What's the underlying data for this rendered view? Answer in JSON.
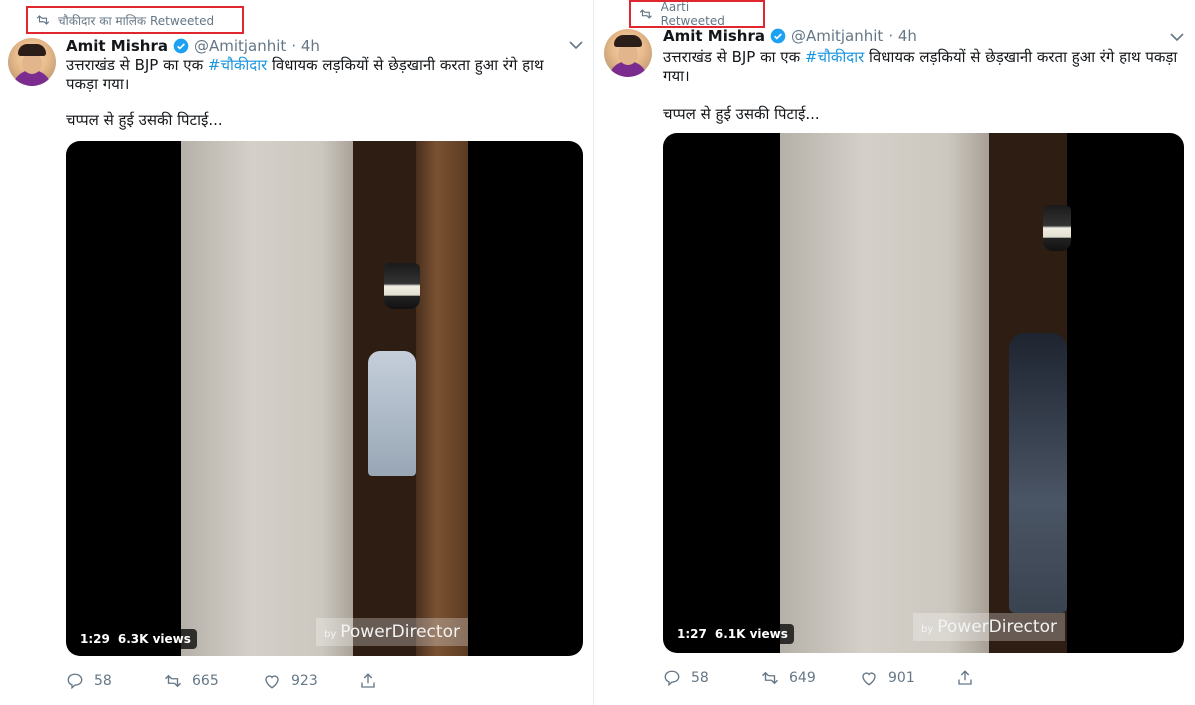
{
  "left": {
    "retweeted_by": "चौकीदार का मालिक",
    "retweeted_suffix": "Retweeted",
    "author_name": "Amit Mishra",
    "handle": "@Amitjanhit",
    "time": "· 4h",
    "text_before_hashtag": "उत्तराखंड से BJP का एक ",
    "hashtag": "#चौकीदार",
    "text_after_hashtag": " विधायक लड़कियों से छेड़खानी करता हुआ रंगे हाथ पकड़ा गया।",
    "text_line2": "चप्पल से हुई उसकी पिटाई...",
    "video_duration": "1:29",
    "video_views": "6.3K views",
    "watermark_small": "by",
    "watermark": "PowerDirector",
    "replies": "58",
    "retweets": "665",
    "likes": "923"
  },
  "right": {
    "retweeted_by": "Aarti",
    "retweeted_suffix": "Retweeted",
    "author_name": "Amit Mishra",
    "handle": "@Amitjanhit",
    "time": "· 4h",
    "text_before_hashtag": "उत्तराखंड से BJP का एक ",
    "hashtag": "#चौकीदार",
    "text_after_hashtag": " विधायक लड़कियों से छेड़खानी करता हुआ रंगे हाथ पकड़ा गया।",
    "text_line2": "चप्पल से हुई उसकी पिटाई...",
    "video_duration": "1:27",
    "video_views": "6.1K views",
    "watermark_small": "by",
    "watermark": "PowerDirector",
    "replies": "58",
    "retweets": "649",
    "likes": "901"
  },
  "colors": {
    "highlight_border": "#e0262f",
    "link": "#1b95e0",
    "secondary_text": "#657786",
    "verified": "#1da1f2"
  },
  "icons": [
    "retweet-icon",
    "verified-badge-icon",
    "chevron-down-icon",
    "reply-icon",
    "like-icon",
    "share-icon"
  ]
}
